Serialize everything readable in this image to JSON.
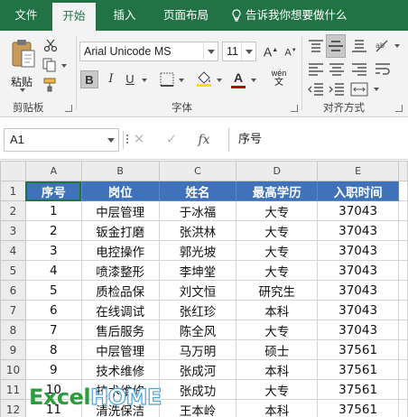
{
  "ribbon": {
    "tabs": [
      "文件",
      "开始",
      "插入",
      "页面布局"
    ],
    "active_tab": "开始",
    "tell_me": "告诉我你想要做什么",
    "clipboard": {
      "paste_label": "粘贴",
      "group_label": "剪贴板"
    },
    "font": {
      "name": "Arial Unicode MS",
      "size": "11",
      "group_label": "字体",
      "bold": "B",
      "italic": "I",
      "underline": "U",
      "grow": "A",
      "shrink": "A",
      "font_color": "A",
      "phonetic": "wén"
    },
    "alignment": {
      "group_label": "对齐方式"
    }
  },
  "formula_bar": {
    "name_box": "A1",
    "fx": "fx",
    "content": "序号"
  },
  "sheet": {
    "columns": [
      "A",
      "B",
      "C",
      "D",
      "E"
    ],
    "rows": [
      {
        "num": "1",
        "cells": [
          "序号",
          "岗位",
          "姓名",
          "最高学历",
          "入职时间"
        ]
      },
      {
        "num": "2",
        "cells": [
          "1",
          "中层管理",
          "于冰福",
          "大专",
          "37043"
        ]
      },
      {
        "num": "3",
        "cells": [
          "2",
          "钣金打磨",
          "张洪林",
          "大专",
          "37043"
        ]
      },
      {
        "num": "4",
        "cells": [
          "3",
          "电控操作",
          "郭光坡",
          "大专",
          "37043"
        ]
      },
      {
        "num": "5",
        "cells": [
          "4",
          "喷漆整形",
          "李坤堂",
          "大专",
          "37043"
        ]
      },
      {
        "num": "6",
        "cells": [
          "5",
          "质检品保",
          "刘文恒",
          "研究生",
          "37043"
        ]
      },
      {
        "num": "7",
        "cells": [
          "6",
          "在线调试",
          "张红珍",
          "本科",
          "37043"
        ]
      },
      {
        "num": "8",
        "cells": [
          "7",
          "售后服务",
          "陈全风",
          "大专",
          "37043"
        ]
      },
      {
        "num": "9",
        "cells": [
          "8",
          "中层管理",
          "马万明",
          "硕士",
          "37561"
        ]
      },
      {
        "num": "10",
        "cells": [
          "9",
          "技术维修",
          "张成河",
          "本科",
          "37561"
        ]
      },
      {
        "num": "11",
        "cells": [
          "10",
          "技术维修",
          "张成功",
          "大专",
          "37561"
        ]
      },
      {
        "num": "12",
        "cells": [
          "11",
          "清洗保洁",
          "王本岭",
          "本科",
          "37561"
        ]
      }
    ]
  },
  "watermark": {
    "part1": "Excel",
    "part2": "HOME"
  },
  "colors": {
    "accent": "#217346",
    "header_fill": "#3f72b8"
  }
}
